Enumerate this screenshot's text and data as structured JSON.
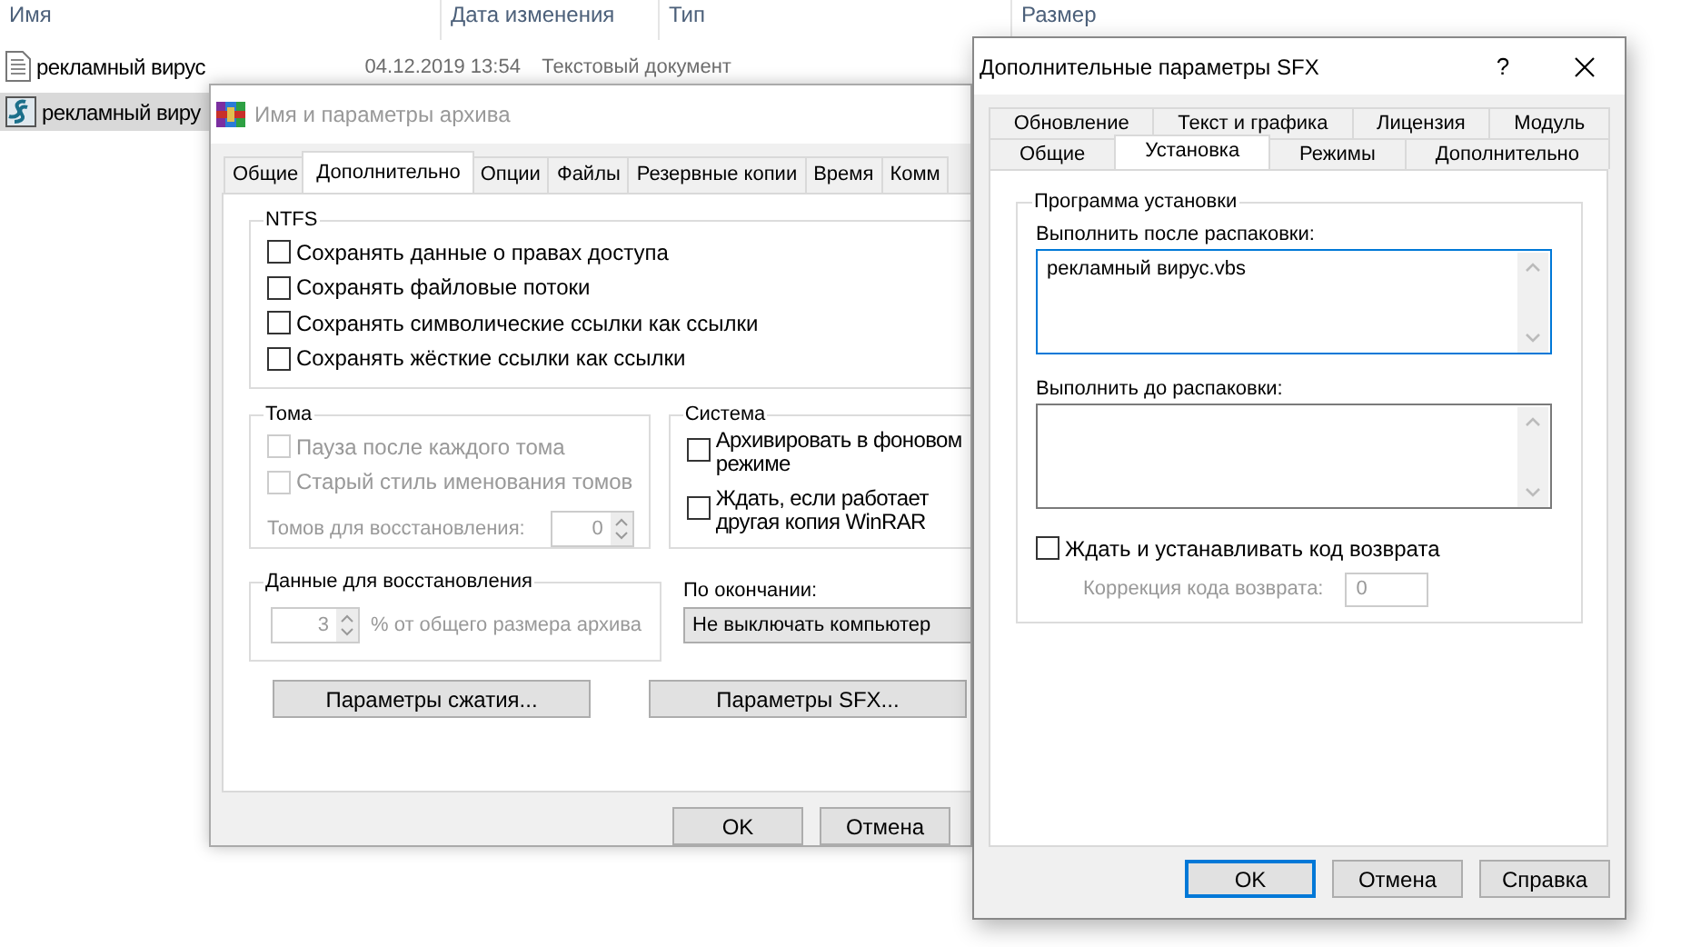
{
  "explorer": {
    "columns": [
      "Имя",
      "Дата изменения",
      "Тип",
      "Размер"
    ],
    "rows": [
      {
        "kind": "text",
        "name": "рекламный вирус",
        "date": "04.12.2019 13:54",
        "type": "Текстовый документ",
        "selected": false
      },
      {
        "kind": "script",
        "name": "рекламный виру",
        "selected": true
      }
    ]
  },
  "archive_dialog": {
    "title": "Имя и параметры архива",
    "tabs": [
      {
        "label": "Общие",
        "selected": false
      },
      {
        "label": "Дополнительно",
        "selected": true
      },
      {
        "label": "Опции",
        "selected": false
      },
      {
        "label": "Файлы",
        "selected": false
      },
      {
        "label": "Резервные копии",
        "selected": false
      },
      {
        "label": "Время",
        "selected": false
      },
      {
        "label": "Комм",
        "selected": false
      }
    ],
    "ntfs": {
      "title": "NTFS",
      "options": [
        {
          "label": "Сохранять данные о правах доступа",
          "checked": false,
          "disabled": false
        },
        {
          "label": "Сохранять файловые потоки",
          "checked": false,
          "disabled": false
        },
        {
          "label": "Сохранять символические ссылки как ссылки",
          "checked": false,
          "disabled": false
        },
        {
          "label": "Сохранять жёсткие ссылки как ссылки",
          "checked": false,
          "disabled": false
        }
      ]
    },
    "volumes": {
      "title": "Тома",
      "options": [
        {
          "label": "Пауза после каждого тома",
          "checked": false,
          "disabled": true
        },
        {
          "label": "Старый стиль именования томов",
          "checked": false,
          "disabled": true
        }
      ],
      "recovery_label": "Томов для восстановления:",
      "recovery_value": "0",
      "disabled": true
    },
    "system": {
      "title": "Система",
      "options": [
        {
          "label": "Архивировать в фоновом режиме",
          "checked": false,
          "disabled": false
        },
        {
          "label": "Ждать, если работает другая копия WinRAR",
          "checked": false,
          "disabled": false
        }
      ]
    },
    "recovery_data": {
      "title": "Данные для восстановления",
      "value": "3",
      "suffix": "% от общего размера архива",
      "disabled": true
    },
    "on_finish": {
      "label": "По окончании:",
      "value": "Не выключать компьютер"
    },
    "buttons": [
      "Параметры сжатия...",
      "Параметры SFX..."
    ],
    "footer_buttons": [
      "OK",
      "Отмена"
    ]
  },
  "sfx_dialog": {
    "title": "Дополнительные параметры SFX",
    "help": "?",
    "tab_rows": [
      [
        {
          "label": "Обновление",
          "selected": false
        },
        {
          "label": "Текст и графика",
          "selected": false
        },
        {
          "label": "Лицензия",
          "selected": false
        },
        {
          "label": "Модуль",
          "selected": false
        }
      ],
      [
        {
          "label": "Общие",
          "selected": false
        },
        {
          "label": "Установка",
          "selected": true
        },
        {
          "label": "Режимы",
          "selected": false
        },
        {
          "label": "Дополнительно",
          "selected": false
        }
      ]
    ],
    "group_title": "Программа установки",
    "fields": [
      {
        "label": "Выполнить после распаковки:",
        "value": "рекламный вирус.vbs",
        "focused": true
      },
      {
        "label": "Выполнить до распаковки:",
        "focused": false
      }
    ],
    "wait_option": {
      "label": "Ждать и устанавливать код возврата",
      "checked": false
    },
    "correction": {
      "label": "Коррекция кода возврата:",
      "value": "0",
      "disabled": true
    },
    "buttons": [
      {
        "label": "OK",
        "default": true
      },
      {
        "label": "Отмена",
        "default": false
      },
      {
        "label": "Справка",
        "default": false
      }
    ]
  }
}
